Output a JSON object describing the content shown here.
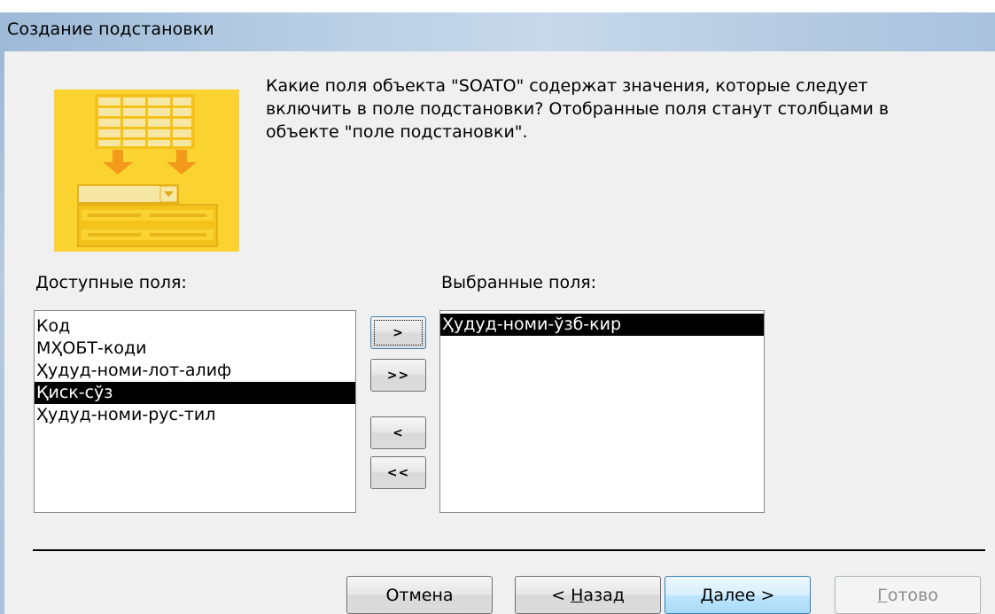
{
  "window": {
    "title": "Создание подстановки"
  },
  "prompt": {
    "line1": "Какие поля объекта \"SOATO\" содержат значения, которые следует",
    "line2": "включить в поле подстановки? Отобранные поля станут столбцами в",
    "line3": "объекте \"поле подстановки\"."
  },
  "available": {
    "label": "Доступные поля:",
    "items": [
      {
        "label": "Код",
        "selected": false
      },
      {
        "label": "МҲОБТ-коди",
        "selected": false
      },
      {
        "label": "Ҳудуд-номи-лот-алиф",
        "selected": false
      },
      {
        "label": "Қиск-сўз",
        "selected": true
      },
      {
        "label": "Ҳудуд-номи-рус-тил",
        "selected": false
      }
    ]
  },
  "selected": {
    "label": "Выбранные поля:",
    "items": [
      {
        "label": "Ҳудуд-номи-ўзб-кир",
        "selected": true
      }
    ]
  },
  "move_buttons": {
    "add_one": ">",
    "add_all": ">>",
    "remove_one": "<",
    "remove_all": "<<"
  },
  "footer": {
    "cancel": "Отмена",
    "back_prefix": "< ",
    "back_mnemonic": "Н",
    "back_rest": "азад",
    "next_mnemonic": "Д",
    "next_rest": "алее >",
    "finish_mnemonic": "Г",
    "finish_rest": "отово"
  },
  "colors": {
    "illustration_bg": "#fbd331",
    "selection": "#000000",
    "dialog_bg": "#f0f0f0"
  }
}
